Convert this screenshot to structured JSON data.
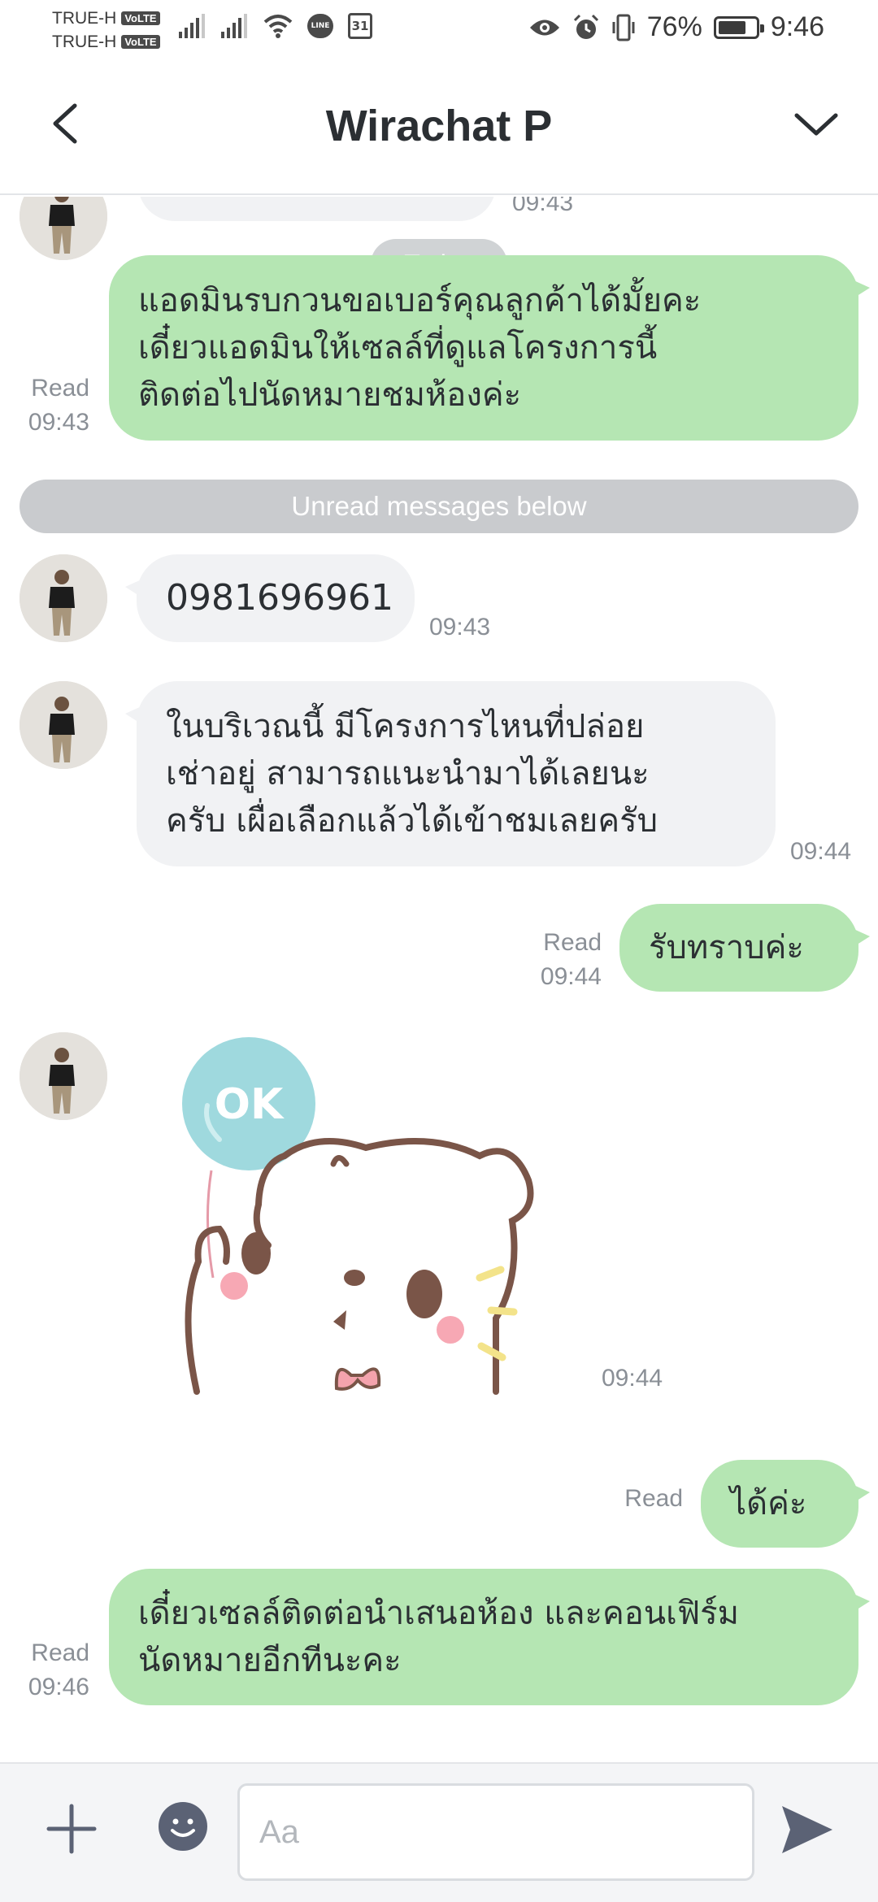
{
  "status_bar": {
    "carrier_1": "TRUE-H",
    "carrier_2": "TRUE-H",
    "volte_label": "VoLTE",
    "line_badge": "LINE",
    "calendar_day": "31",
    "battery": "76%",
    "time": "9:46",
    "battery_level": 0.76,
    "icons": [
      "signal-icon",
      "wifi-icon",
      "line-icon",
      "calendar-icon",
      "eye-icon",
      "alarm-icon",
      "vibrate-icon",
      "battery-icon"
    ]
  },
  "header": {
    "title": "Wirachat P",
    "back_icon": "chevron-left-icon",
    "menu_icon": "chevron-down-icon"
  },
  "chat": {
    "prev_time": "09:43",
    "today_label": "Today",
    "unread_label": "Unread messages below",
    "messages": [
      {
        "direction": "out",
        "text": "แอดมินรบกวนขอเบอร์คุณลูกค้าได้มั้ยคะ\nเดี๋ยวแอดมินให้เซลล์ที่ดูแลโครงการนี้\nติดต่อไปนัดหมายชมห้องค่ะ",
        "status": "Read",
        "time": "09:43"
      },
      {
        "direction": "in",
        "text": "0981696961",
        "time": "09:43"
      },
      {
        "direction": "in",
        "text": "ในบริเวณนี้ มีโครงการไหนที่ปล่อย\nเช่าอยู่ สามารถแนะนำมาได้เลยนะ\nครับ เผื่อเลือกแล้วได้เข้าชมเลยครับ",
        "time": "09:44"
      },
      {
        "direction": "out",
        "text": "รับทราบค่ะ",
        "status": "Read",
        "time": "09:44"
      },
      {
        "direction": "in",
        "type": "sticker",
        "sticker_text": "OK",
        "time": "09:44"
      },
      {
        "direction": "out",
        "text": "ได้ค่ะ",
        "status": "Read"
      },
      {
        "direction": "out",
        "text": "เดี๋ยวเซลล์ติดต่อนำเสนอห้อง และคอนเฟิร์ม\nนัดหมายอีกทีนะคะ",
        "status": "Read",
        "time": "09:46"
      }
    ]
  },
  "input_bar": {
    "placeholder": "Aa",
    "plus_icon": "plus-icon",
    "emoji_icon": "emoji-icon",
    "send_icon": "send-icon"
  },
  "colors": {
    "outgoing_bubble": "#b5e6b3",
    "incoming_bubble": "#f1f2f4",
    "meta_text": "#8a8f96",
    "icon": "#5b6275"
  }
}
